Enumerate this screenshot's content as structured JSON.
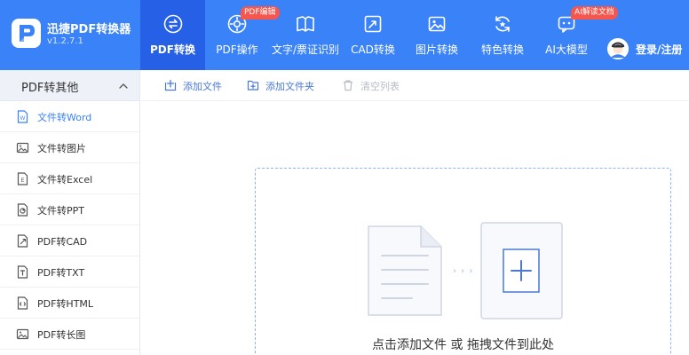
{
  "app": {
    "name": "迅捷PDF转换器",
    "version": "v1.2.7.1"
  },
  "nav": [
    {
      "label": "PDF转换",
      "active": true
    },
    {
      "label": "PDF操作",
      "badge": "PDF编辑"
    },
    {
      "label": "文字/票证识别"
    },
    {
      "label": "CAD转换"
    },
    {
      "label": "图片转换"
    },
    {
      "label": "特色转换"
    },
    {
      "label": "AI大模型",
      "badge": "AI解读文档"
    }
  ],
  "user": {
    "login_label": "登录/注册"
  },
  "sidebar": {
    "header": "PDF转其他",
    "items": [
      {
        "label": "文件转Word",
        "icon_text": "W",
        "active": true
      },
      {
        "label": "文件转图片"
      },
      {
        "label": "文件转Excel",
        "icon_text": "E"
      },
      {
        "label": "文件转PPT"
      },
      {
        "label": "PDF转CAD"
      },
      {
        "label": "PDF转TXT"
      },
      {
        "label": "PDF转HTML"
      },
      {
        "label": "PDF转长图"
      }
    ]
  },
  "toolbar": {
    "add_file": "添加文件",
    "add_folder": "添加文件夹",
    "clear_list": "清空列表"
  },
  "dropzone": {
    "arrows": "› › ›",
    "hint": "点击添加文件 或 拖拽文件到此处"
  },
  "colors": {
    "header_bg": "#3a82f8",
    "active_tab_bg": "#2660e6",
    "accent": "#3a82f8",
    "badge": "#f5564e"
  }
}
